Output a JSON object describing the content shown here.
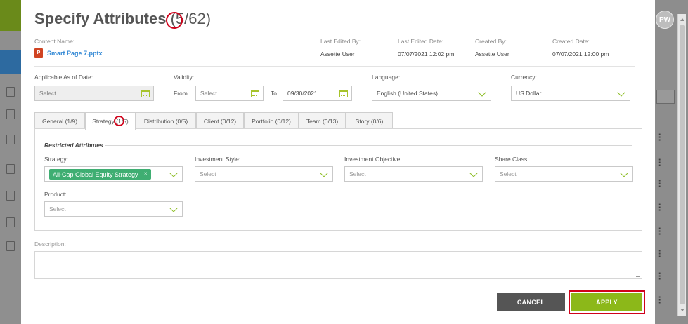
{
  "modal": {
    "title": "Specify Attributes",
    "count_selected": "5",
    "count_total": "/62)",
    "count_open": "("
  },
  "meta": {
    "content_name_label": "Content Name:",
    "content_name_value": "Smart Page 7.pptx",
    "last_edited_by_label": "Last Edited By:",
    "last_edited_by_value": "Assette User",
    "last_edited_date_label": "Last Edited Date:",
    "last_edited_date_value": "07/07/2021 12:02 pm",
    "created_by_label": "Created By:",
    "created_by_value": "Assette User",
    "created_date_label": "Created Date:",
    "created_date_value": "07/07/2021 12:00 pm"
  },
  "fields": {
    "applicable_label": "Applicable As of Date:",
    "applicable_placeholder": "Select",
    "validity_label": "Validity:",
    "from_label": "From",
    "from_placeholder": "Select",
    "to_label": "To",
    "to_value": "09/30/2021",
    "language_label": "Language:",
    "language_value": "English (United States)",
    "currency_label": "Currency:",
    "currency_value": "US Dollar"
  },
  "tabs": [
    {
      "label": "General (1/9)"
    },
    {
      "label": "Strategy (1/5)"
    },
    {
      "label": "Distribution (0/5)"
    },
    {
      "label": "Client (0/12)"
    },
    {
      "label": "Portfolio (0/12)"
    },
    {
      "label": "Team (0/13)"
    },
    {
      "label": "Story (0/6)"
    }
  ],
  "strategy_tab": {
    "section_title": "Restricted Attributes",
    "strategy_label": "Strategy:",
    "strategy_tag": "All-Cap Global Equity Strategy",
    "strategy_tag_remove": "×",
    "investment_style_label": "Investment Style:",
    "investment_style_placeholder": "Select",
    "investment_objective_label": "Investment Objective:",
    "investment_objective_placeholder": "Select",
    "share_class_label": "Share Class:",
    "share_class_placeholder": "Select",
    "product_label": "Product:",
    "product_placeholder": "Select"
  },
  "description": {
    "label": "Description:"
  },
  "buttons": {
    "cancel": "CANCEL",
    "apply": "APPLY"
  },
  "user": {
    "initials": "PW"
  },
  "colors": {
    "accent_green": "#8cb819",
    "tag_green": "#3fae72",
    "link_blue": "#2e86d4",
    "highlight_red": "#d0021b",
    "cancel_gray": "#555555"
  },
  "icons": [
    "calendar-icon",
    "chevron-down-icon",
    "powerpoint-file-icon",
    "kebab-menu-icon",
    "close-icon",
    "resize-handle-icon"
  ]
}
